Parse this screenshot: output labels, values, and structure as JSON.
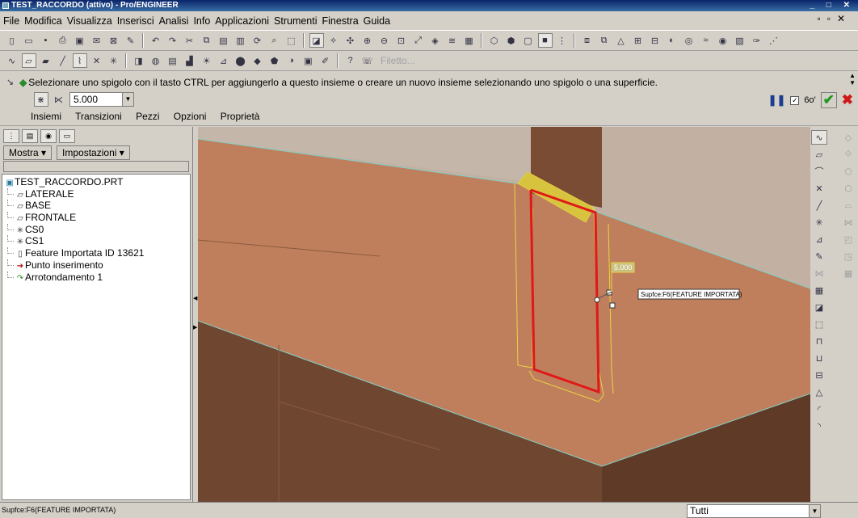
{
  "window": {
    "title": "TEST_RACCORDO (attivo) - Pro/ENGINEER"
  },
  "menu": {
    "items": [
      "File",
      "Modifica",
      "Visualizza",
      "Inserisci",
      "Analisi",
      "Info",
      "Applicazioni",
      "Strumenti",
      "Finestra",
      "Guida"
    ]
  },
  "toolbar": {
    "filter_placeholder": "Filetto..."
  },
  "dashboard": {
    "prompt": "Selezionare uno spigolo con il tasto CTRL per aggiungerlo a questo insieme o creare un nuovo insieme selezionando uno spigolo o una superficie.",
    "radius_value": "5.000",
    "tabs": [
      "Insiemi",
      "Transizioni",
      "Pezzi",
      "Opzioni",
      "Proprietà"
    ],
    "preview_glyph": "6o'"
  },
  "panel": {
    "show_button": "Mostra",
    "settings_button": "Impostazioni",
    "tree": [
      {
        "label": "TEST_RACCORDO.PRT",
        "icon": "part-icon"
      },
      {
        "label": "LATERALE",
        "icon": "datum-plane-icon"
      },
      {
        "label": "BASE",
        "icon": "datum-plane-icon"
      },
      {
        "label": "FRONTALE",
        "icon": "datum-plane-icon"
      },
      {
        "label": "CS0",
        "icon": "coordinate-system-icon"
      },
      {
        "label": "CS1",
        "icon": "coordinate-system-icon"
      },
      {
        "label": "Feature Importata ID 13621",
        "icon": "imported-feature-icon"
      },
      {
        "label": "Punto inserimento",
        "icon": "insert-arrow-icon"
      },
      {
        "label": "Arrotondamento 1",
        "icon": "round-feature-icon"
      }
    ]
  },
  "viewport": {
    "radius_tag": "5.000",
    "surface_tag": "Supfce:F6(FEATURE IMPORTATA)"
  },
  "status": {
    "message": "Supfce:F6(FEATURE IMPORTATA)",
    "filter_value": "Tutti"
  }
}
